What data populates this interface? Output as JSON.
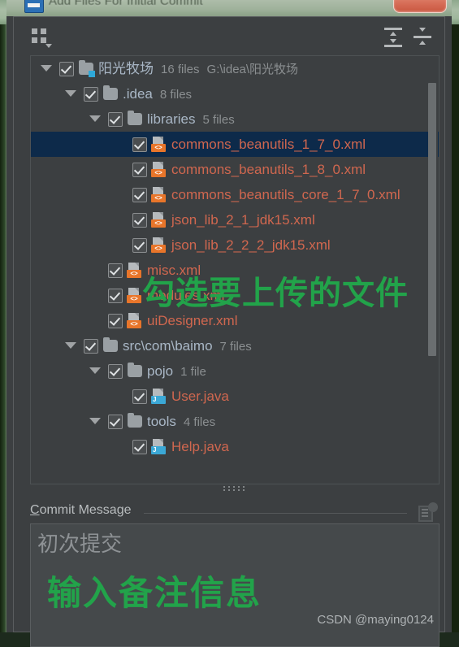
{
  "window": {
    "title": "Add Files For Initial Commit",
    "icon": "intellij-commit-icon",
    "close_button": "close-button"
  },
  "toolbar": {
    "group_by": "Group By",
    "expand_all": "Expand All",
    "collapse_all": "Collapse All"
  },
  "tree": {
    "rows": [
      {
        "depth": 0,
        "twisty": "expanded",
        "checked": true,
        "icon": "module-folder-icon",
        "label": "阳光牧场",
        "label_kind": "dir",
        "meta": "16 files",
        "path": "G:\\idea\\阳光牧场",
        "selected": false
      },
      {
        "depth": 1,
        "twisty": "expanded",
        "checked": true,
        "icon": "folder-icon",
        "label": ".idea",
        "label_kind": "dir",
        "meta": "8 files",
        "path": "",
        "selected": false
      },
      {
        "depth": 2,
        "twisty": "expanded",
        "checked": true,
        "icon": "folder-icon",
        "label": "libraries",
        "label_kind": "dir",
        "meta": "5 files",
        "path": "",
        "selected": false
      },
      {
        "depth": 3,
        "twisty": "none",
        "checked": true,
        "icon": "xml-file-icon",
        "label": "commons_beanutils_1_7_0.xml",
        "label_kind": "file",
        "meta": "",
        "path": "",
        "selected": true
      },
      {
        "depth": 3,
        "twisty": "none",
        "checked": true,
        "icon": "xml-file-icon",
        "label": "commons_beanutils_1_8_0.xml",
        "label_kind": "file",
        "meta": "",
        "path": "",
        "selected": false
      },
      {
        "depth": 3,
        "twisty": "none",
        "checked": true,
        "icon": "xml-file-icon",
        "label": "commons_beanutils_core_1_7_0.xml",
        "label_kind": "file",
        "meta": "",
        "path": "",
        "selected": false
      },
      {
        "depth": 3,
        "twisty": "none",
        "checked": true,
        "icon": "xml-file-icon",
        "label": "json_lib_2_1_jdk15.xml",
        "label_kind": "file",
        "meta": "",
        "path": "",
        "selected": false
      },
      {
        "depth": 3,
        "twisty": "none",
        "checked": true,
        "icon": "xml-file-icon",
        "label": "json_lib_2_2_2_jdk15.xml",
        "label_kind": "file",
        "meta": "",
        "path": "",
        "selected": false
      },
      {
        "depth": 2,
        "twisty": "none",
        "checked": true,
        "icon": "xml-file-icon",
        "label": "misc.xml",
        "label_kind": "file",
        "meta": "",
        "path": "",
        "selected": false
      },
      {
        "depth": 2,
        "twisty": "none",
        "checked": true,
        "icon": "xml-file-icon",
        "label": "modules.xml",
        "label_kind": "file",
        "meta": "",
        "path": "",
        "selected": false
      },
      {
        "depth": 2,
        "twisty": "none",
        "checked": true,
        "icon": "xml-file-icon",
        "label": "uiDesigner.xml",
        "label_kind": "file",
        "meta": "",
        "path": "",
        "selected": false
      },
      {
        "depth": 1,
        "twisty": "expanded",
        "checked": true,
        "icon": "folder-icon",
        "label": "src\\com\\baimo",
        "label_kind": "dir",
        "meta": "7 files",
        "path": "",
        "selected": false
      },
      {
        "depth": 2,
        "twisty": "expanded",
        "checked": true,
        "icon": "folder-icon",
        "label": "pojo",
        "label_kind": "dir",
        "meta": "1 file",
        "path": "",
        "selected": false
      },
      {
        "depth": 3,
        "twisty": "none",
        "checked": true,
        "icon": "java-file-icon",
        "label": "User.java",
        "label_kind": "file",
        "meta": "",
        "path": "",
        "selected": false
      },
      {
        "depth": 2,
        "twisty": "expanded",
        "checked": true,
        "icon": "folder-icon",
        "label": "tools",
        "label_kind": "dir",
        "meta": "4 files",
        "path": "",
        "selected": false
      },
      {
        "depth": 3,
        "twisty": "none",
        "checked": true,
        "icon": "java-file-icon",
        "label": "Help.java",
        "label_kind": "file",
        "meta": "",
        "path": "",
        "selected": false
      }
    ]
  },
  "commit": {
    "label_mnemonic": "C",
    "label_rest": "ommit Message",
    "value": "初次提交",
    "history_icon": "commit-message-history-icon"
  },
  "annotations": {
    "tree_note": "勾选要上传的文件",
    "commit_note": "输入备注信息",
    "color": "#22a34a"
  },
  "watermark": "CSDN @maying0124"
}
